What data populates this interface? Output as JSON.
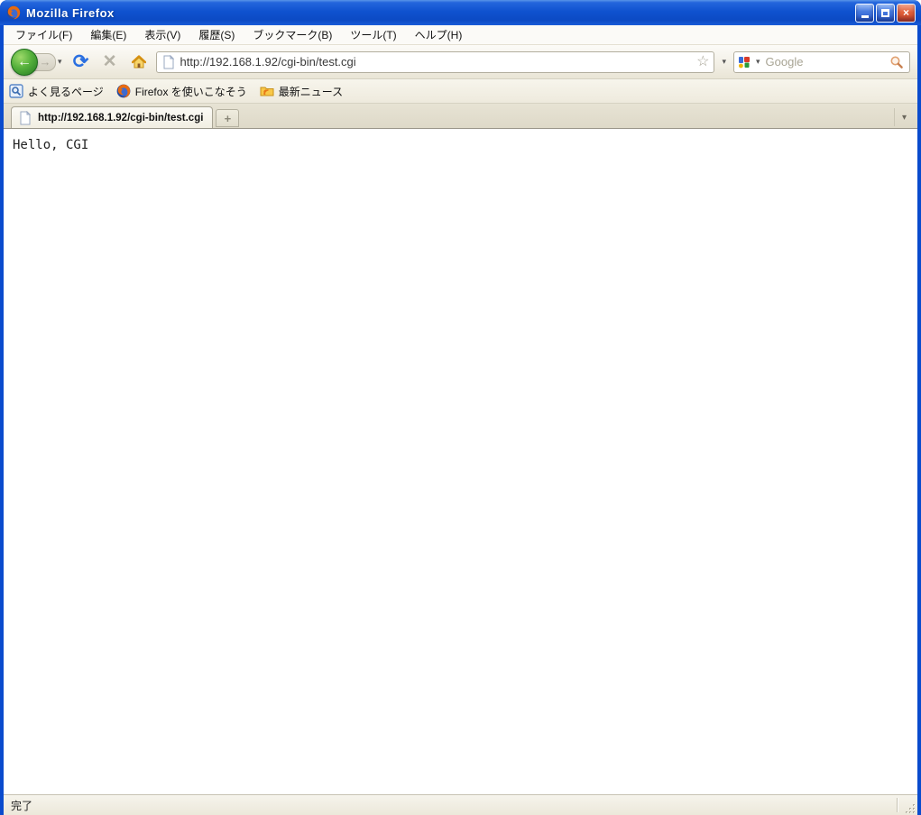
{
  "window": {
    "title": "Mozilla Firefox",
    "controls": {
      "minimize": "minimize",
      "maximize": "maximize",
      "close": "close"
    }
  },
  "menu": {
    "items": [
      "ファイル(F)",
      "編集(E)",
      "表示(V)",
      "履歴(S)",
      "ブックマーク(B)",
      "ツール(T)",
      "ヘルプ(H)"
    ]
  },
  "nav": {
    "back_glyph": "←",
    "forward_glyph": "→",
    "dropdown_glyph": "▾",
    "reload_glyph": "⟳",
    "stop_glyph": "✕",
    "url_value": "http://192.168.1.92/cgi-bin/test.cgi",
    "star_glyph": "☆",
    "search": {
      "placeholder": "Google",
      "engine": "Google"
    }
  },
  "bookmarks": {
    "items": [
      {
        "label": "よく見るページ",
        "icon": "smart-folder-icon"
      },
      {
        "label": "Firefox を使いこなそう",
        "icon": "firefox-icon"
      },
      {
        "label": "最新ニュース",
        "icon": "live-bookmark-icon"
      }
    ]
  },
  "tabs": {
    "active_tab_label": "http://192.168.1.92/cgi-bin/test.cgi",
    "new_tab_glyph": "+",
    "alltabs_glyph": "▾"
  },
  "content": {
    "text": "Hello, CGI"
  },
  "status": {
    "text": "完了"
  },
  "colors": {
    "titlebar_blue": "#0f52cf",
    "frame_blue": "#0a4bcd",
    "toolbar_beige": "#f1efe2",
    "close_button_red": "#d9512e",
    "back_button_green": "#3f9a32"
  }
}
